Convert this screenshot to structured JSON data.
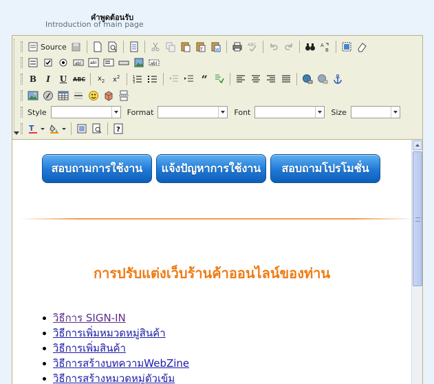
{
  "field": {
    "title": "คำพูดต้อนรับ",
    "subtitle": "Introduction of main page"
  },
  "toolbar": {
    "source_label": "Source",
    "style_label": "Style",
    "format_label": "Format",
    "font_label": "Font",
    "size_label": "Size",
    "style_value": "",
    "format_value": "",
    "font_value": "",
    "size_value": ""
  },
  "content": {
    "buttons": [
      {
        "label": "สอบถามการใช้งาน"
      },
      {
        "label": "แจ้งปัญหาการใช้งาน"
      },
      {
        "label": "สอบถามโปรโมชั่น"
      }
    ],
    "heading": "การปรับแต่งเว็บร้านค้าออนไลน์ของท่าน",
    "links": [
      {
        "label": "วิธีการ SIGN-IN"
      },
      {
        "label": "วิธีการเพิ่มหมวดหมู่สินค้า"
      },
      {
        "label": "วิธีการเพิ่มสินค้า"
      },
      {
        "label": "วิธีการสร้างบทความWebZine"
      },
      {
        "label": "วิธีการสร้างหมวดหมู่ตัวเข้ม"
      }
    ]
  },
  "colors": {
    "button_blue": "#1f78d6",
    "heading_orange": "#f07a12",
    "link_blue": "#1a1aa8",
    "link_visited": "#5a2d8c",
    "toolbar_bg": "#efefde",
    "page_bg": "#eaf3fb"
  }
}
